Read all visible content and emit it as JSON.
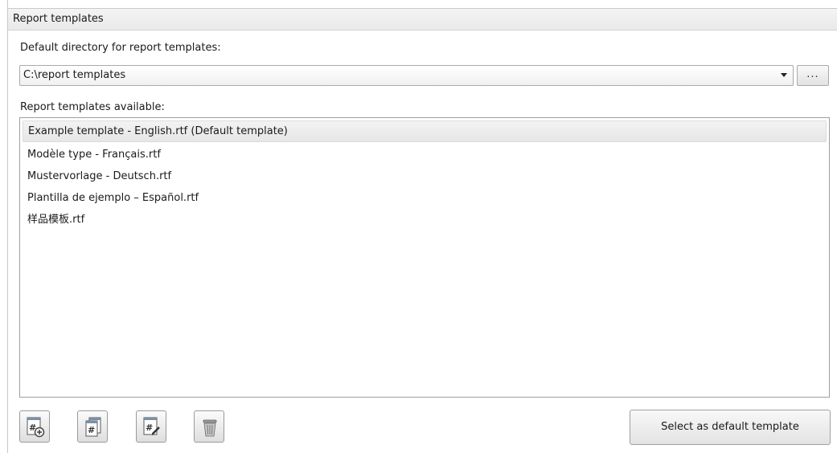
{
  "panel": {
    "title": "Report templates"
  },
  "directory": {
    "label": "Default directory for report templates:",
    "value": "C:\\report templates",
    "browse_label": "..."
  },
  "templates": {
    "label": "Report templates available:",
    "items": [
      "Example template - English.rtf (Default template)",
      "Modèle type - Français.rtf",
      "Mustervorlage - Deutsch.rtf",
      "Plantilla de ejemplo – Español.rtf",
      "样品模板.rtf"
    ],
    "selected_index": 0
  },
  "toolbar": {
    "icons": [
      "add-template-icon",
      "copy-template-icon",
      "edit-template-icon",
      "delete-template-icon"
    ],
    "default_button_label": "Select as default template"
  }
}
